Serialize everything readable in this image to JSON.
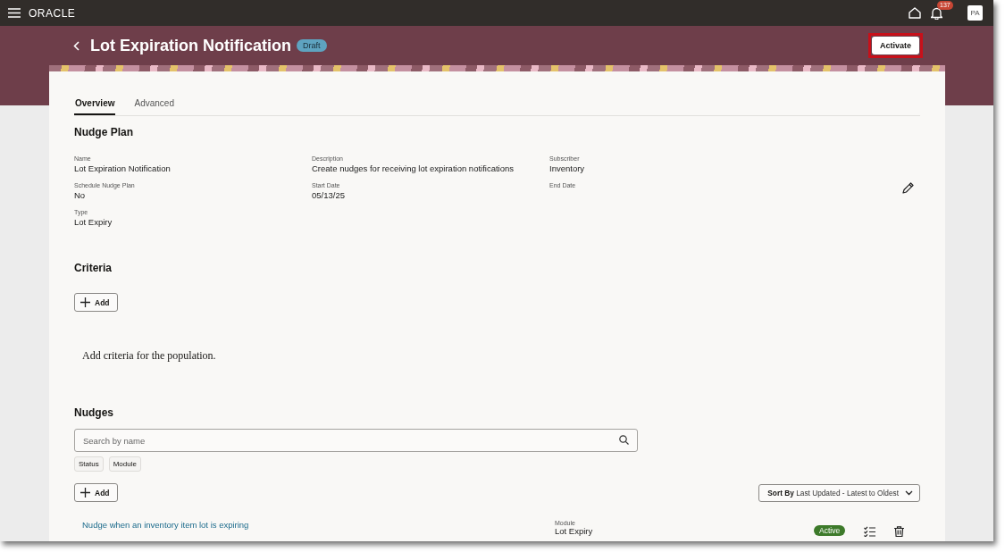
{
  "topbar": {
    "brand": "ORACLE",
    "notification_count": "137",
    "avatar_initials": "PA"
  },
  "header": {
    "title": "Lot Expiration Notification",
    "status_badge": "Draft",
    "primary_action": "Activate"
  },
  "tabs": [
    {
      "label": "Overview",
      "selected": true
    },
    {
      "label": "Advanced",
      "selected": false
    }
  ],
  "nudge_plan": {
    "heading": "Nudge Plan",
    "fields": [
      {
        "label": "Name",
        "value": "Lot Expiration Notification"
      },
      {
        "label": "Description",
        "value": "Create nudges for receiving lot expiration notifications"
      },
      {
        "label": "Subscriber",
        "value": "Inventory"
      },
      {
        "label": "Schedule Nudge Plan",
        "value": "No"
      },
      {
        "label": "Start Date",
        "value": "05/13/25"
      },
      {
        "label": "End Date"
      },
      {
        "label": "Type",
        "value": "Lot Expiry"
      }
    ]
  },
  "criteria": {
    "heading": "Criteria",
    "add_button": "Add",
    "empty_message": "Add criteria for the population."
  },
  "nudges": {
    "heading": "Nudges",
    "search": {
      "placeholder": "Search by name"
    },
    "filters": [
      "Status",
      "Module"
    ],
    "add_button": "Add",
    "sort": {
      "label": "Sort By",
      "value": "Last Updated - Latest to Oldest"
    },
    "items": [
      {
        "name": "Nudge when an inventory item lot is expiring",
        "module_label": "Module",
        "module": "Lot Expiry",
        "status": "Active",
        "color": "#3d7a2a"
      }
    ]
  }
}
